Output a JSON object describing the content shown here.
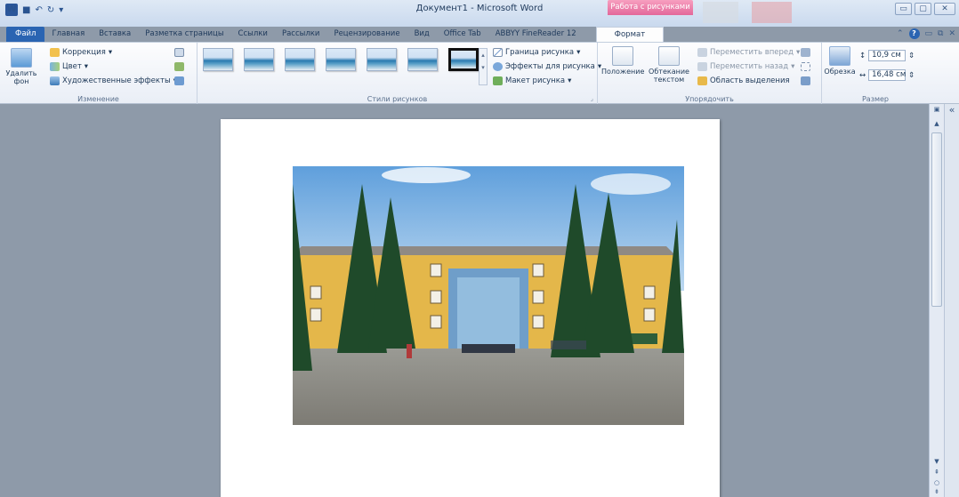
{
  "window": {
    "title": "Документ1 - Microsoft Word",
    "contextual_tab_group": "Работа с рисунками"
  },
  "tabs": [
    "Файл",
    "Главная",
    "Вставка",
    "Разметка страницы",
    "Ссылки",
    "Рассылки",
    "Рецензирование",
    "Вид",
    "Office Tab",
    "ABBYY FineReader 12"
  ],
  "active_tab": "Формат",
  "ribbon": {
    "change_group": {
      "label": "Изменение",
      "remove_bg": "Удалить фон",
      "correction": "Коррекция",
      "color": "Цвет",
      "artistic": "Художественные эффекты"
    },
    "styles_group": {
      "label": "Стили рисунков",
      "border": "Граница рисунка",
      "effects": "Эффекты для рисунка",
      "layout": "Макет рисунка"
    },
    "arrange_group": {
      "label": "Упорядочить",
      "position": "Положение",
      "wrap": "Обтекание текстом",
      "forward": "Переместить вперед",
      "backward": "Переместить назад",
      "selection": "Область выделения"
    },
    "size_group": {
      "label": "Размер",
      "crop": "Обрезка",
      "height": "10,9 см",
      "width": "16,48 см"
    }
  },
  "colors": {
    "accent": "#2a64b2",
    "contextual": "#e3689a",
    "workspace": "#8e9aa9"
  }
}
